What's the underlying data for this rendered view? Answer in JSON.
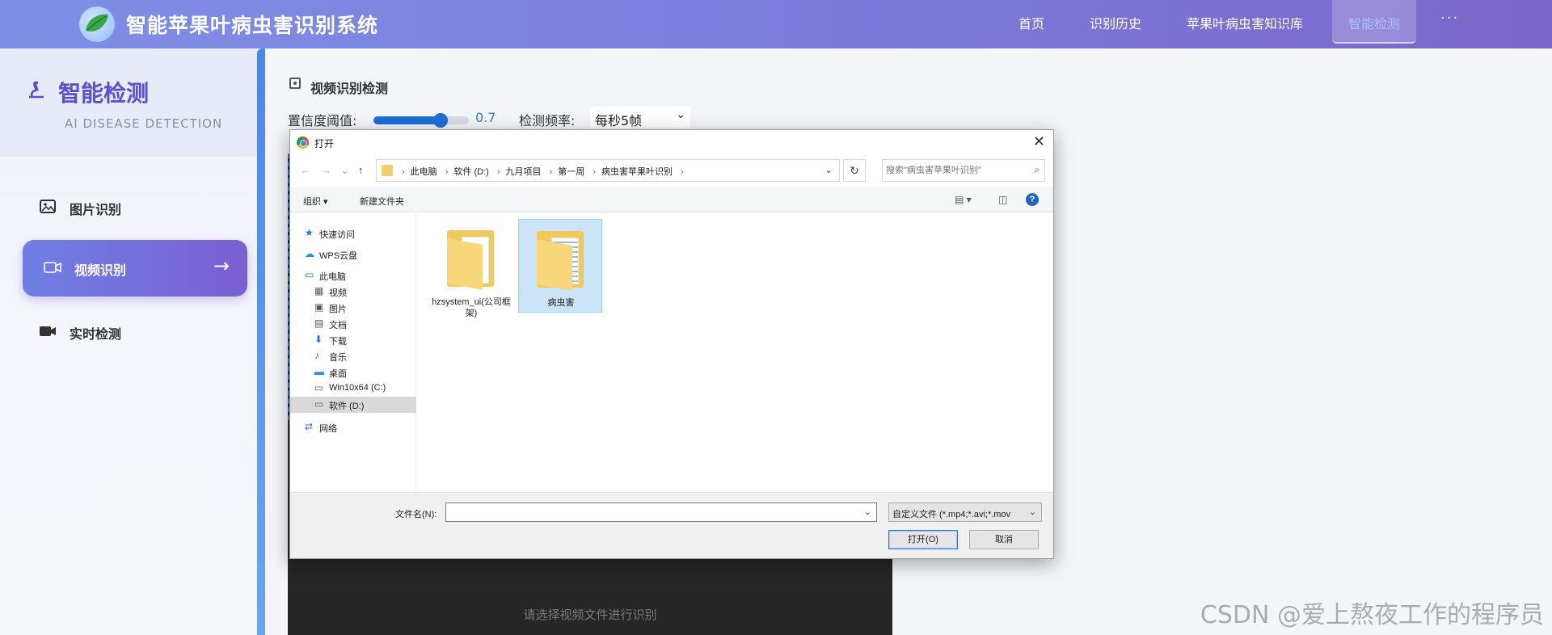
{
  "app": {
    "title": "智能苹果叶病虫害识别系统",
    "nav": [
      "首页",
      "识别历史",
      "苹果叶病虫害知识库",
      "智能检测"
    ],
    "more": "···"
  },
  "sidebar": {
    "title": "智能检测",
    "subtitle": "AI DISEASE DETECTION",
    "items": [
      {
        "label": "图片识别",
        "icon": "image-icon"
      },
      {
        "label": "视频识别",
        "icon": "video-icon",
        "active": true,
        "arrow": "→"
      },
      {
        "label": "实时检测",
        "icon": "camera-icon"
      }
    ]
  },
  "main": {
    "section_title": "视频识别检测",
    "confidence_label": "置信度阈值:",
    "confidence_value": "0.7",
    "confidence_fraction": 0.7,
    "frequency_label": "检测频率:",
    "frequency_value": "每秒5帧",
    "video_hint": "请选择视频文件进行识别"
  },
  "dialog": {
    "title": "打开",
    "breadcrumbs": [
      "此电脑",
      "软件 (D:)",
      "九月项目",
      "第一周",
      "病虫害苹果叶识别"
    ],
    "search_placeholder": "搜索\"病虫害苹果叶识别\"",
    "toolbar": {
      "organize": "组织 ▾",
      "new_folder": "新建文件夹",
      "help": "?"
    },
    "tree": [
      {
        "label": "快速访问",
        "icon": "★"
      },
      {
        "label": "WPS云盘",
        "icon": "☁"
      },
      {
        "label": "此电脑",
        "icon": "🖳"
      },
      {
        "label": "视频",
        "icon": "▦"
      },
      {
        "label": "图片",
        "icon": "▣"
      },
      {
        "label": "文档",
        "icon": "▤"
      },
      {
        "label": "下载",
        "icon": "⬇"
      },
      {
        "label": "音乐",
        "icon": "♪"
      },
      {
        "label": "桌面",
        "icon": "▬"
      },
      {
        "label": "Win10x64 (C:)",
        "icon": "▭"
      },
      {
        "label": "软件 (D:)",
        "icon": "▭"
      },
      {
        "label": "网络",
        "icon": "⇄"
      }
    ],
    "files": [
      {
        "name": "hzsystem_ui(公司框架)"
      },
      {
        "name": "病虫害",
        "selected": true
      }
    ],
    "filename_label": "文件名(N):",
    "filename_value": "",
    "filetype": "自定义文件 (*.mp4;*.avi;*.mov",
    "open_button": "打开(O)",
    "cancel_button": "取消"
  },
  "watermark": "CSDN @爱上熬夜工作的程序员",
  "colors": {
    "accent": "#6f7fe4",
    "slider": "#1f6fd6",
    "folder": "#f0c85c"
  }
}
